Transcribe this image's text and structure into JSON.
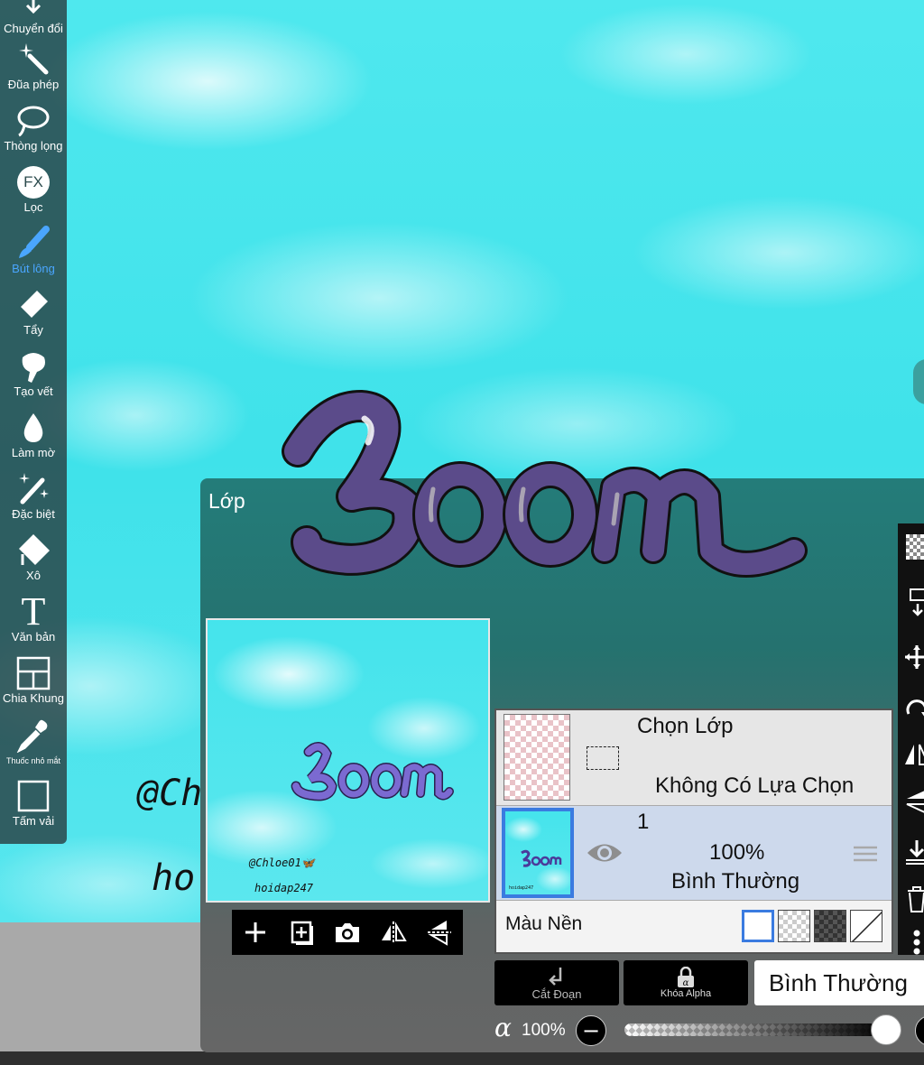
{
  "canvas": {
    "handwriting_1": "@Ch",
    "handwriting_2": "ho"
  },
  "toolbar": {
    "items": [
      {
        "label": "Chuyển đổi",
        "icon": "transform-icon"
      },
      {
        "label": "Đũa phép",
        "icon": "magic-wand-icon"
      },
      {
        "label": "Thòng lọng",
        "icon": "lasso-icon"
      },
      {
        "label": "Lọc",
        "icon": "fx-filter-icon",
        "glyph": "FX"
      },
      {
        "label": "Bút lông",
        "icon": "brush-icon",
        "active": true
      },
      {
        "label": "Tẩy",
        "icon": "eraser-icon"
      },
      {
        "label": "Tạo vết",
        "icon": "smudge-icon"
      },
      {
        "label": "Làm mờ",
        "icon": "blur-drop-icon"
      },
      {
        "label": "Đặc biệt",
        "icon": "special-pen-icon"
      },
      {
        "label": "Xô",
        "icon": "bucket-icon"
      },
      {
        "label": "Văn bản",
        "icon": "text-icon",
        "glyph": "T"
      },
      {
        "label": "Chia Khung",
        "icon": "frame-divider-icon"
      },
      {
        "label": "Thuốc nhỏ mắt",
        "icon": "eyedropper-icon"
      },
      {
        "label": "Tấm vải",
        "icon": "canvas-icon"
      }
    ],
    "active_color": "#4aa6ff"
  },
  "layer_panel": {
    "title": "Lớp",
    "preview": {
      "caption_1": "@Chloe01🦋",
      "caption_2": "hoidap247"
    },
    "selection_row": {
      "title": "Chọn Lớp",
      "status": "Không Có Lựa Chọn"
    },
    "layer_row": {
      "number": "1",
      "opacity": "100%",
      "blend": "Bình Thường"
    },
    "background_row": {
      "label": "Màu Nền"
    },
    "clip_button": "Cắt Đoạn",
    "alpha_lock_button": "Khóa Alpha",
    "blend_mode": "Bình Thường",
    "opacity": {
      "symbol": "α",
      "value_text": "100%",
      "value": 1.0,
      "minus": "−"
    }
  },
  "colors": {
    "accent_blue": "#3a7be0",
    "lettering_purple": "#5b4b8a"
  }
}
